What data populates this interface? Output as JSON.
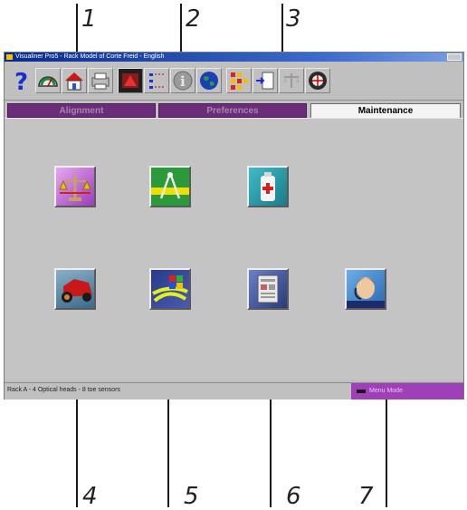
{
  "callouts": {
    "top": [
      "1",
      "2",
      "3"
    ],
    "bottom": [
      "4",
      "5",
      "6",
      "7"
    ]
  },
  "window": {
    "title": "Visualiner Pro5 - Rack Model of Corte Freid - English",
    "toolbar_icons": [
      "help-icon",
      "speedometer-icon",
      "home-icon",
      "printer-icon",
      "vehicle-specs-icon",
      "measurement-icon",
      "info-icon",
      "globe-icon",
      "sensors-icon",
      "import-icon",
      "balance-icon",
      "wheel-icon"
    ]
  },
  "tabs": [
    {
      "label": "Alignment",
      "active": false
    },
    {
      "label": "Preferences",
      "active": false
    },
    {
      "label": "Maintenance",
      "active": true
    }
  ],
  "maintenance_icons": [
    "scale-calibration-icon",
    "compass-drafting-icon",
    "first-aid-icon",
    "car-icon",
    "windows-icon",
    "document-icon",
    "support-person-icon"
  ],
  "status": {
    "left": "Rack A - 4 Optical heads - 8 toe sensors",
    "right": "Menu Mode"
  },
  "colors": {
    "tab_inactive": "#6b2d7a",
    "status_mode": "#a040b8",
    "panel": "#c4c4c4"
  }
}
